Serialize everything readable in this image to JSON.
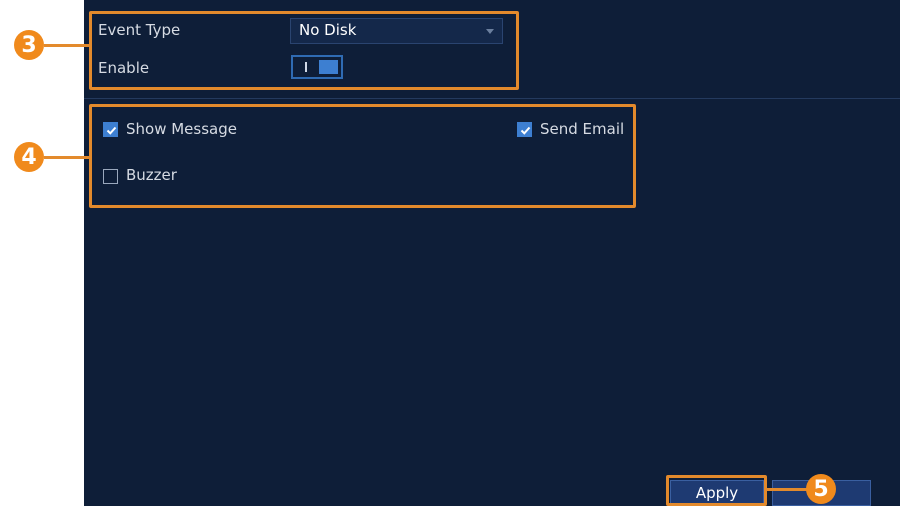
{
  "event": {
    "type_label": "Event Type",
    "type_value": "No Disk",
    "enable_label": "Enable"
  },
  "actions": {
    "show_message": "Show Message",
    "send_email": "Send Email",
    "buzzer": "Buzzer",
    "show_message_checked": true,
    "send_email_checked": true,
    "buzzer_checked": false
  },
  "buttons": {
    "apply": "Apply",
    "second": ""
  },
  "callouts": {
    "c3": "3",
    "c4": "4",
    "c5": "5"
  },
  "colors": {
    "panel_bg": "#0e1e38",
    "accent_orange": "#e38a2c",
    "checkbox_blue": "#3d7fd1"
  }
}
